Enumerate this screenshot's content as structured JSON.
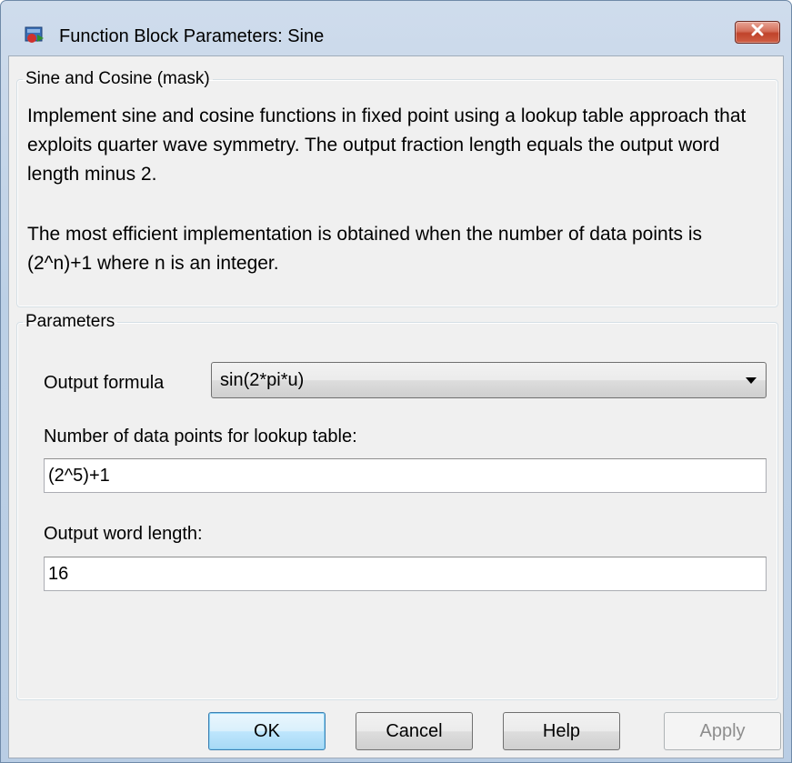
{
  "window": {
    "title": "Function Block Parameters: Sine",
    "close_icon": "close-x-icon",
    "app_icon": "simulink-block-icon"
  },
  "mask_group": {
    "legend": "Sine and Cosine (mask)",
    "description_1": "Implement sine and cosine functions in fixed point using a lookup table approach that exploits quarter wave symmetry. The output fraction length equals the output word length minus 2.",
    "description_2": "The most efficient implementation is obtained when the number of data points is (2^n)+1 where n is an integer."
  },
  "parameters_group": {
    "legend": "Parameters",
    "output_formula_label": "Output formula",
    "output_formula_value": "sin(2*pi*u)",
    "data_points_label": "Number of data points for lookup table:",
    "data_points_value": "(2^5)+1",
    "word_length_label": "Output word length:",
    "word_length_value": "16"
  },
  "buttons": {
    "ok": "OK",
    "cancel": "Cancel",
    "help": "Help",
    "apply": "Apply"
  },
  "colors": {
    "title_gradient": "#bcd0e6",
    "close_button": "#c0432b",
    "dialog_background": "#f0f0f0",
    "default_button_border": "#3c7fb1"
  }
}
